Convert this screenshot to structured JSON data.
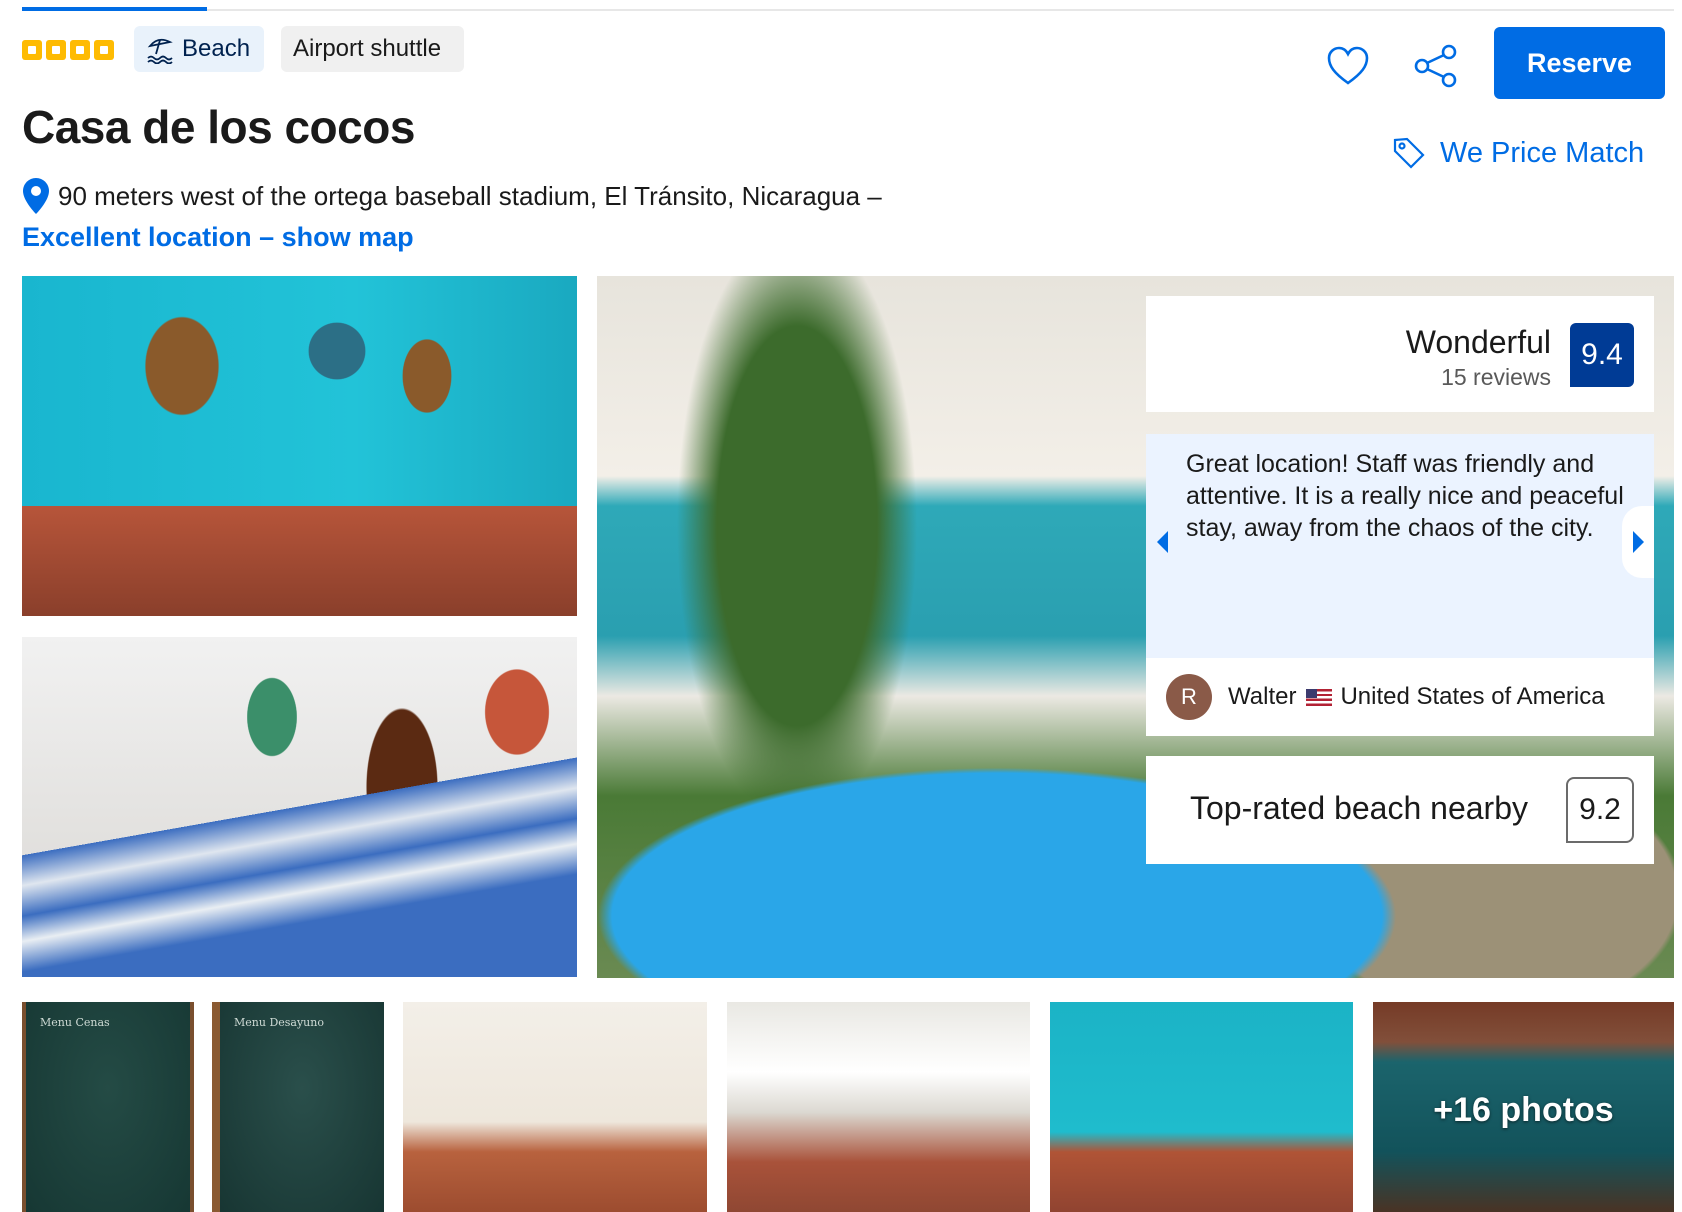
{
  "header": {
    "star_rating": 4,
    "tags": {
      "beach": "Beach",
      "airport_shuttle": "Airport shuttle"
    },
    "reserve_label": "Reserve",
    "price_match_label": "We Price Match"
  },
  "property": {
    "name": "Casa de los cocos",
    "address": "90 meters west of the ortega baseball stadium, El Tránsito, Nicaragua –",
    "map_link": "Excellent location – show map"
  },
  "review_summary": {
    "score_word": "Wonderful",
    "review_count": "15 reviews",
    "score": "9.4",
    "quote": "Great location! Staff was friendly and attentive. It is a really nice and peaceful stay, away from the chaos of the city.",
    "reviewer_initial": "R",
    "reviewer_name": "Walter",
    "reviewer_country": "United States of America",
    "highlight_label": "Top-rated beach nearby",
    "highlight_score": "9.2"
  },
  "gallery": {
    "more_photos_label": "+16 photos",
    "thumb_menu_1_heading": "Menu Cenas",
    "thumb_menu_2_heading": "Menu Desayuno"
  },
  "colors": {
    "brand_blue": "#006ce4",
    "score_navy": "#003b95",
    "star_yellow": "#febb02",
    "quote_bg": "#ebf3ff"
  }
}
